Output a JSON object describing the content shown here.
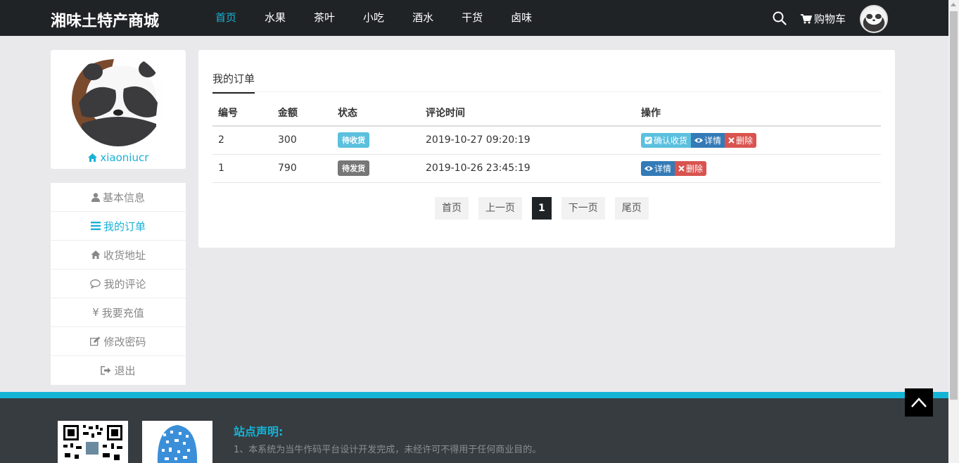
{
  "header": {
    "brand": "湘味土特产商城",
    "nav": [
      "首页",
      "水果",
      "茶叶",
      "小吃",
      "酒水",
      "干货",
      "卤味"
    ],
    "active_nav": 0,
    "cart_label": "购物车"
  },
  "profile": {
    "username": "xiaoniucr"
  },
  "sidebar": {
    "items": [
      {
        "label": "基本信息",
        "icon": "user-icon"
      },
      {
        "label": "我的订单",
        "icon": "list-icon"
      },
      {
        "label": "收货地址",
        "icon": "home-icon"
      },
      {
        "label": "我的评论",
        "icon": "comment-icon"
      },
      {
        "label": "我要充值",
        "icon": "yen-icon"
      },
      {
        "label": "修改密码",
        "icon": "edit-icon"
      },
      {
        "label": "退出",
        "icon": "sign-out-icon"
      }
    ],
    "active_index": 1
  },
  "orders": {
    "tab_title": "我的订单",
    "columns": [
      "编号",
      "金额",
      "状态",
      "评论时间",
      "操作"
    ],
    "rows": [
      {
        "id": "2",
        "amount": "300",
        "status": "待收货",
        "status_color": "#5bc0de",
        "time": "2019-10-27 09:20:19"
      },
      {
        "id": "1",
        "amount": "790",
        "status": "待发货",
        "status_color": "#777777",
        "time": "2019-10-26 23:45:19"
      }
    ],
    "actions": {
      "confirm": "确认收货",
      "detail": "详情",
      "delete": "删除"
    }
  },
  "pagination": {
    "first": "首页",
    "prev": "上一页",
    "current": "1",
    "next": "下一页",
    "last": "尾页"
  },
  "footer": {
    "title": "站点声明:",
    "line1": "1、本系统为当牛作码平台设计开发完成，未经许可不得用于任何商业目的。"
  },
  "colors": {
    "accent": "#1ab1d6",
    "topbar": "#202326",
    "info": "#5bc0de",
    "primary": "#337ab7",
    "danger": "#d9534f"
  }
}
